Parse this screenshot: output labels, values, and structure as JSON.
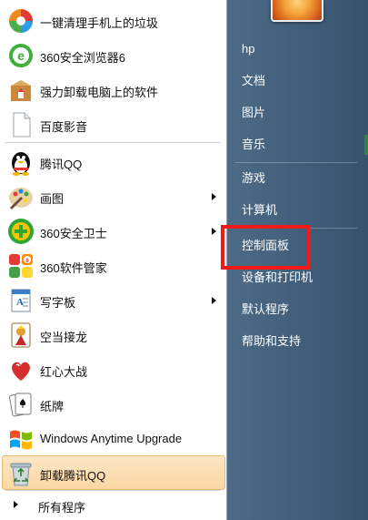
{
  "programs": [
    {
      "label": "一键清理手机上的垃圾",
      "icon": "phone-cleaner-icon",
      "submenu": false
    },
    {
      "label": "360安全浏览器6",
      "icon": "360-browser-icon",
      "submenu": false
    },
    {
      "label": "强力卸载电脑上的软件",
      "icon": "uninstall-box-icon",
      "submenu": false
    },
    {
      "label": "百度影音",
      "icon": "document-icon",
      "submenu": false
    },
    {
      "label": "腾讯QQ",
      "icon": "qq-penguin-icon",
      "submenu": false
    },
    {
      "label": "画图",
      "icon": "paint-palette-icon",
      "submenu": true
    },
    {
      "label": "360安全卫士",
      "icon": "360-guard-icon",
      "submenu": true
    },
    {
      "label": "360软件管家",
      "icon": "360-software-manager-icon",
      "submenu": false
    },
    {
      "label": "写字板",
      "icon": "wordpad-icon",
      "submenu": true
    },
    {
      "label": "空当接龙",
      "icon": "freecell-icon",
      "submenu": false
    },
    {
      "label": "红心大战",
      "icon": "hearts-icon",
      "submenu": false
    },
    {
      "label": "纸牌",
      "icon": "solitaire-icon",
      "submenu": false
    },
    {
      "label": "Windows Anytime Upgrade",
      "icon": "windows-logo-icon",
      "submenu": false
    },
    {
      "label": "卸载腾讯QQ",
      "icon": "recycle-bin-icon",
      "submenu": false,
      "selected": true
    }
  ],
  "all_programs_label": "所有程序",
  "right_items": [
    "hp",
    "文档",
    "图片",
    "音乐",
    "游戏",
    "计算机",
    "控制面板",
    "设备和打印机",
    "默认程序",
    "帮助和支持"
  ],
  "highlighted_item": "控制面板",
  "colors": {
    "highlight_box": "#f11a1a",
    "selected_bg": "#fbd7a4",
    "panel_dark": "#3f5d79"
  }
}
